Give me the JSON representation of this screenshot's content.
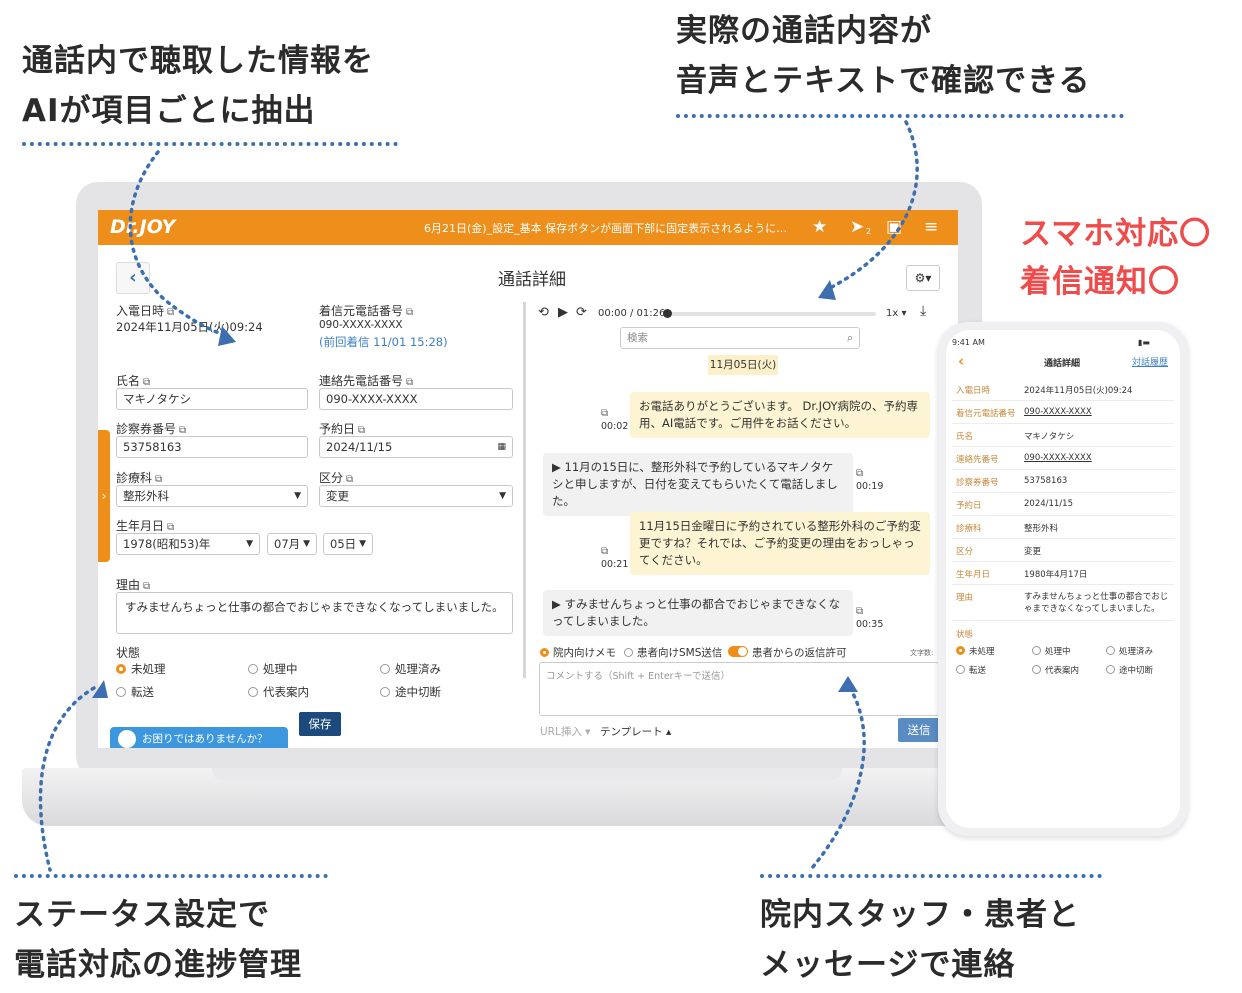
{
  "callouts": {
    "top_left": [
      "通話内で聴取した情報を",
      "AIが項目ごとに抽出"
    ],
    "top_right": [
      "実際の通話内容が",
      "音声とテキストで確認できる"
    ],
    "right_red": [
      "スマホ対応〇",
      "着信通知〇"
    ],
    "bottom_left": [
      "ステータス設定で",
      "電話対応の進捗管理"
    ],
    "bottom_right": [
      "院内スタッフ・患者と",
      "メッセージで連絡"
    ]
  },
  "app": {
    "logo": "Dr.JOY",
    "notice": "6月21日(金)_設定_基本 保存ボタンが画面下部に固定表示されるように…",
    "icons": [
      "star-icon",
      "send-icon",
      "video-icon",
      "menu-icon"
    ],
    "badge": "2",
    "page_title": "通話詳細",
    "back_icon": "‹",
    "gear_label": "⚙▾"
  },
  "form": {
    "received_label": "入電日時",
    "received_value": "2024年11月05日(火)09:24",
    "caller_label": "着信元電話番号",
    "caller_value": "090-XXXX-XXXX",
    "previous_call": "(前回着信 11/01 15:28)",
    "name_label": "氏名",
    "name_value": "マキノタケシ",
    "contact_label": "連絡先電話番号",
    "contact_value": "090-XXXX-XXXX",
    "card_label": "診察券番号",
    "card_value": "53758163",
    "appt_label": "予約日",
    "appt_value": "2024/11/15",
    "dept_label": "診療科",
    "dept_value": "整形外科",
    "category_label": "区分",
    "category_value": "変更",
    "birth_label": "生年月日",
    "birth_year": "1978(昭和53)年",
    "birth_month": "07月",
    "birth_day": "05日",
    "reason_label": "理由",
    "reason_value": "すみませんちょっと仕事の都合でおじゃまできなくなってしまいました。",
    "status_label": "状態",
    "status_options": [
      "未処理",
      "処理中",
      "処理済み",
      "転送",
      "代表案内",
      "途中切断"
    ],
    "status_selected": "未処理",
    "save_button": "保存",
    "help_text": "お困りではありませんか？"
  },
  "player": {
    "time": "00:00 / 01:26",
    "speed": "1x",
    "search_placeholder": "検索",
    "date_chip": "11月05日(火)"
  },
  "messages": [
    {
      "speaker": "ai",
      "text": "お電話ありがとうございます。 Dr.JOY病院の、予約専用、AI電話です。ご用件をお話ください。",
      "time": "00:02"
    },
    {
      "speaker": "patient",
      "text": "▶ 11月の15日に、整形外科で予約しているマキノタケシと申しますが、日付を変えてもらいたくて電話しました。",
      "time": "00:19"
    },
    {
      "speaker": "ai",
      "text": "11月15日金曜日に予約されている整形外科のご予約変更ですね？それでは、ご予約変更の理由をおっしゃってください。",
      "time": "00:21"
    },
    {
      "speaker": "patient",
      "text": "▶ すみませんちょっと仕事の都合でおじゃまできなくなってしまいました。",
      "time": "00:35"
    }
  ],
  "chat": {
    "opt_internal": "院内向けメモ",
    "opt_sms": "患者向けSMS送信",
    "opt_reply": "患者からの返信許可",
    "char_count": "文字数:",
    "comment_placeholder": "コメントする（Shift + Enterキーで送信）",
    "url_insert": "URL挿入",
    "template": "テンプレート",
    "send_button": "送信"
  },
  "phone": {
    "status_time": "9:41 AM",
    "title": "通話詳細",
    "history_link": "対話履歴",
    "rows": [
      {
        "k": "入電日時",
        "v": "2024年11月05日(火)09:24"
      },
      {
        "k": "着信元電話番号",
        "v": "090-XXXX-XXXX"
      },
      {
        "k": "氏名",
        "v": "マキノタケシ"
      },
      {
        "k": "連絡先番号",
        "v": "090-XXXX-XXXX"
      },
      {
        "k": "診察券番号",
        "v": "53758163"
      },
      {
        "k": "予約日",
        "v": "2024/11/15"
      },
      {
        "k": "診療科",
        "v": "整形外科"
      },
      {
        "k": "区分",
        "v": "変更"
      },
      {
        "k": "生年月日",
        "v": "1980年4月17日"
      }
    ],
    "reason_label": "理由",
    "reason_value": "すみませんちょっと仕事の都合でおじゃまできなくなってしまいました。",
    "status_label": "状態",
    "status_options": [
      "未処理",
      "処理中",
      "処理済み",
      "転送",
      "代表案内",
      "途中切断"
    ]
  },
  "colors": {
    "brand": "#ee8f1c",
    "navy": "#1c4a7c",
    "accent_red": "#ef4b4b",
    "dots": "#3d6fb0"
  }
}
